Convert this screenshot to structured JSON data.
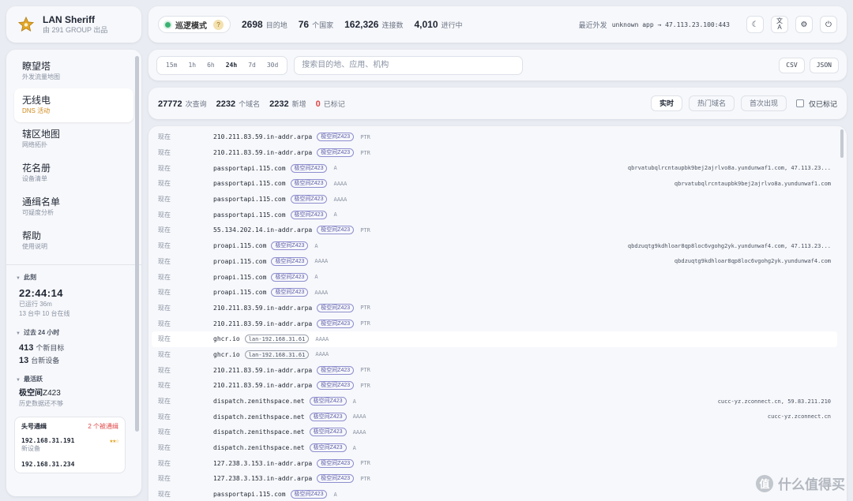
{
  "brand": {
    "name": "LAN Sheriff",
    "sub": "由 291 GROUP 出品"
  },
  "header": {
    "mode_label": "巡逻模式",
    "mode_help": "?",
    "stats": [
      {
        "value": "2698",
        "unit": "目的地"
      },
      {
        "value": "76",
        "unit": "个国家"
      },
      {
        "value": "162,326",
        "unit": "连接数"
      },
      {
        "value": "4,010",
        "unit": "进行中"
      }
    ],
    "last_out_label": "最近外发",
    "last_out_value": "unknown app → 47.113.23.100:443",
    "icons": {
      "theme": "☾",
      "translate_top": "文",
      "translate_bottom": "A",
      "settings": "⚙",
      "power": "⏻"
    }
  },
  "sidebar": {
    "nav": [
      {
        "title": "瞭望塔",
        "sub": "外发流量地图"
      },
      {
        "title": "无线电",
        "sub": "DNS 活动"
      },
      {
        "title": "辖区地图",
        "sub": "网络拓扑"
      },
      {
        "title": "花名册",
        "sub": "设备清单"
      },
      {
        "title": "通缉名单",
        "sub": "可疑度分析"
      },
      {
        "title": "帮助",
        "sub": "使用说明"
      }
    ],
    "now": {
      "heading": "此刻",
      "clock": "22:44:14",
      "uptime": "已运行 36m",
      "online": "13 台中 10 台在线"
    },
    "past24": {
      "heading": "过去 24 小时",
      "new_targets_n": "413",
      "new_targets_l": "个新目标",
      "new_devices_n": "13",
      "new_devices_l": "台新设备"
    },
    "most_active": {
      "heading": "最活跃",
      "name_bold": "极空间",
      "name_rest": "Z423",
      "note": "历史数据还不够"
    },
    "wanted": {
      "heading": "头号通缉",
      "count": "2 个被通缉",
      "items": [
        {
          "ip": "192.168.31.191",
          "stars": "★★☆",
          "sub": "新设备"
        },
        {
          "ip": "192.168.31.234",
          "stars": "",
          "sub": ""
        }
      ]
    }
  },
  "toolbar": {
    "ranges": [
      "15m",
      "1h",
      "6h",
      "24h",
      "7d",
      "30d"
    ],
    "search_placeholder": "搜索目的地、应用、机构",
    "export_csv": "CSV",
    "export_json": "JSON"
  },
  "summary": {
    "queries_v": "27772",
    "queries_u": "次查询",
    "domains_v": "2232",
    "domains_u": "个域名",
    "new_v": "2232",
    "new_u": "新增",
    "flagged_v": "0",
    "flagged_u": "已标记",
    "tabs": [
      "实时",
      "热门域名",
      "首次出现"
    ],
    "flagged_only": "仅已标记"
  },
  "log": [
    {
      "t": "现在",
      "d": "210.211.83.59.in-addr.arpa",
      "dev": "极空间Z423",
      "q": "PTR",
      "a": ""
    },
    {
      "t": "现在",
      "d": "210.211.83.59.in-addr.arpa",
      "dev": "极空间Z423",
      "q": "PTR",
      "a": ""
    },
    {
      "t": "现在",
      "d": "passportapi.115.com",
      "dev": "极空间Z423",
      "q": "A",
      "a": "qbrvatubqlrcntaupbk9bej2ajrlvo8a.yundunwaf1.com, 47.113.23..."
    },
    {
      "t": "现在",
      "d": "passportapi.115.com",
      "dev": "极空间Z423",
      "q": "AAAA",
      "a": "qbrvatubqlrcntaupbk9bej2ajrlvo8a.yundunwaf1.com"
    },
    {
      "t": "现在",
      "d": "passportapi.115.com",
      "dev": "极空间Z423",
      "q": "AAAA",
      "a": ""
    },
    {
      "t": "现在",
      "d": "passportapi.115.com",
      "dev": "极空间Z423",
      "q": "A",
      "a": ""
    },
    {
      "t": "现在",
      "d": "55.134.202.14.in-addr.arpa",
      "dev": "极空间Z423",
      "q": "PTR",
      "a": ""
    },
    {
      "t": "现在",
      "d": "proapi.115.com",
      "dev": "极空间Z423",
      "q": "A",
      "a": "qbdzuqtg9kdhloar8qp8loc6vgohg2yk.yundunwaf4.com, 47.113.23..."
    },
    {
      "t": "现在",
      "d": "proapi.115.com",
      "dev": "极空间Z423",
      "q": "AAAA",
      "a": "qbdzuqtg9kdhloar8qp8loc6vgohg2yk.yundunwaf4.com"
    },
    {
      "t": "现在",
      "d": "proapi.115.com",
      "dev": "极空间Z423",
      "q": "A",
      "a": ""
    },
    {
      "t": "现在",
      "d": "proapi.115.com",
      "dev": "极空间Z423",
      "q": "AAAA",
      "a": ""
    },
    {
      "t": "现在",
      "d": "210.211.83.59.in-addr.arpa",
      "dev": "极空间Z423",
      "q": "PTR",
      "a": ""
    },
    {
      "t": "现在",
      "d": "210.211.83.59.in-addr.arpa",
      "dev": "极空间Z423",
      "q": "PTR",
      "a": ""
    },
    {
      "t": "现在",
      "d": "ghcr.io",
      "dev": "lan-192.168.31.61",
      "q": "AAAA",
      "a": "",
      "lan": true,
      "hl": true
    },
    {
      "t": "现在",
      "d": "ghcr.io",
      "dev": "lan-192.168.31.61",
      "q": "AAAA",
      "a": "",
      "lan": true
    },
    {
      "t": "现在",
      "d": "210.211.83.59.in-addr.arpa",
      "dev": "极空间Z423",
      "q": "PTR",
      "a": ""
    },
    {
      "t": "现在",
      "d": "210.211.83.59.in-addr.arpa",
      "dev": "极空间Z423",
      "q": "PTR",
      "a": ""
    },
    {
      "t": "现在",
      "d": "dispatch.zenithspace.net",
      "dev": "极空间Z423",
      "q": "A",
      "a": "cucc-yz.zconnect.cn, 59.83.211.210"
    },
    {
      "t": "现在",
      "d": "dispatch.zenithspace.net",
      "dev": "极空间Z423",
      "q": "AAAA",
      "a": "cucc-yz.zconnect.cn"
    },
    {
      "t": "现在",
      "d": "dispatch.zenithspace.net",
      "dev": "极空间Z423",
      "q": "AAAA",
      "a": ""
    },
    {
      "t": "现在",
      "d": "dispatch.zenithspace.net",
      "dev": "极空间Z423",
      "q": "A",
      "a": ""
    },
    {
      "t": "现在",
      "d": "127.238.3.153.in-addr.arpa",
      "dev": "极空间Z423",
      "q": "PTR",
      "a": ""
    },
    {
      "t": "现在",
      "d": "127.238.3.153.in-addr.arpa",
      "dev": "极空间Z423",
      "q": "PTR",
      "a": ""
    },
    {
      "t": "现在",
      "d": "passportapi.115.com",
      "dev": "极空间Z423",
      "q": "A",
      "a": ""
    }
  ],
  "watermark": {
    "glyph": "值",
    "text": "什么值得买"
  },
  "colors": {
    "accent": "#d08a1a",
    "device_tag": "#5b5aa8",
    "flag_red": "#e04848",
    "online_green": "#3bb273"
  }
}
